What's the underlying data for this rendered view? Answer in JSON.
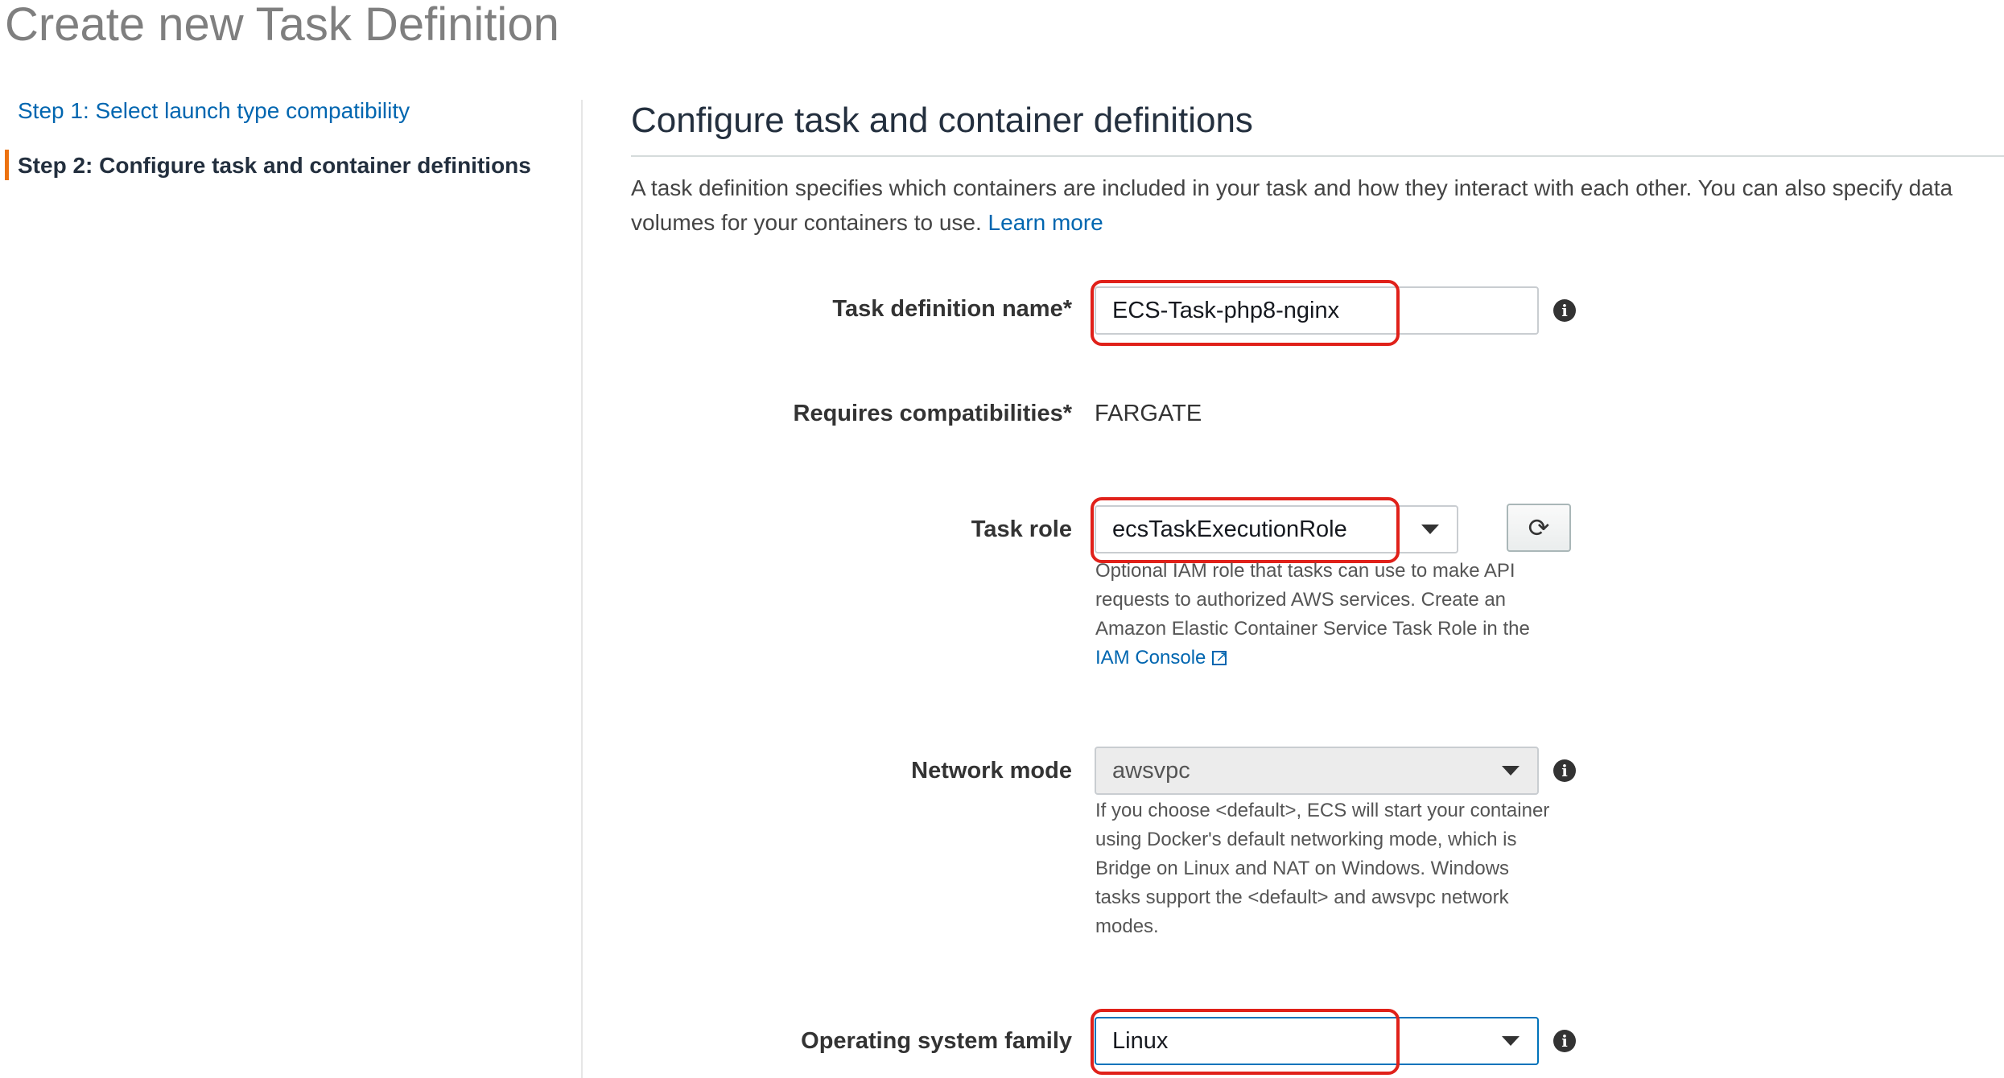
{
  "page": {
    "title": "Create new Task Definition"
  },
  "steps": [
    {
      "label": "Step 1: Select launch type compatibility",
      "state": "link"
    },
    {
      "label": "Step 2: Configure task and container definitions",
      "state": "active"
    }
  ],
  "section": {
    "title": "Configure task and container definitions",
    "description": "A task definition specifies which containers are included in your task and how they interact with each other. You can also specify data volumes for your containers to use.",
    "learn_more": "Learn more"
  },
  "form": {
    "task_definition_name": {
      "label": "Task definition name*",
      "value": "ECS-Task-php8-nginx"
    },
    "requires_compatibilities": {
      "label": "Requires compatibilities*",
      "value": "FARGATE"
    },
    "task_role": {
      "label": "Task role",
      "value": "ecsTaskExecutionRole",
      "help": "Optional IAM role that tasks can use to make API requests to authorized AWS services. Create an Amazon Elastic Container Service Task Role in the",
      "help_link": "IAM Console"
    },
    "network_mode": {
      "label": "Network mode",
      "value": "awsvpc",
      "help": "If you choose <default>, ECS will start your container using Docker's default networking mode, which is Bridge on Linux and NAT on Windows. Windows tasks support the <default> and awsvpc network modes."
    },
    "operating_system_family": {
      "label": "Operating system family",
      "value": "Linux"
    }
  },
  "icons": {
    "info": "info-icon",
    "refresh": "refresh-icon",
    "external_link": "external-link-icon",
    "dropdown": "chevron-down-icon"
  },
  "colors": {
    "link": "#0066b0",
    "active_step_marker": "#ec7211",
    "annotation_highlight": "#e0211a",
    "focus_border": "#0073bb"
  }
}
